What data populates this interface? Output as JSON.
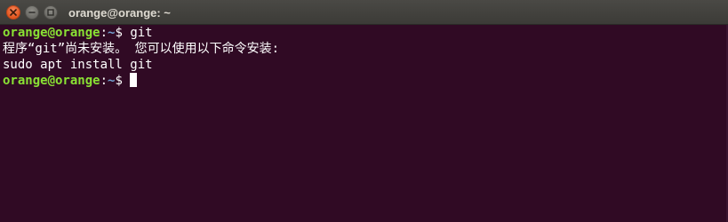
{
  "window": {
    "title": "orange@orange: ~"
  },
  "terminal": {
    "lines": [
      {
        "prompt_user_host": "orange@orange",
        "prompt_sep": ":",
        "prompt_path": "~",
        "prompt_symbol": "$ ",
        "command": "git"
      },
      {
        "output": "程序“git”尚未安装。 您可以使用以下命令安装:"
      },
      {
        "output": "sudo apt install git"
      },
      {
        "prompt_user_host": "orange@orange",
        "prompt_sep": ":",
        "prompt_path": "~",
        "prompt_symbol": "$ ",
        "command": ""
      }
    ]
  },
  "colors": {
    "background": "#300a24",
    "titlebar": "#3c3b37",
    "prompt_user": "#8ae234",
    "prompt_path": "#729fcf",
    "text": "#ffffff",
    "close_button": "#e2561f"
  },
  "icons": {
    "close": "close-icon",
    "minimize": "minimize-icon",
    "maximize": "maximize-icon"
  }
}
